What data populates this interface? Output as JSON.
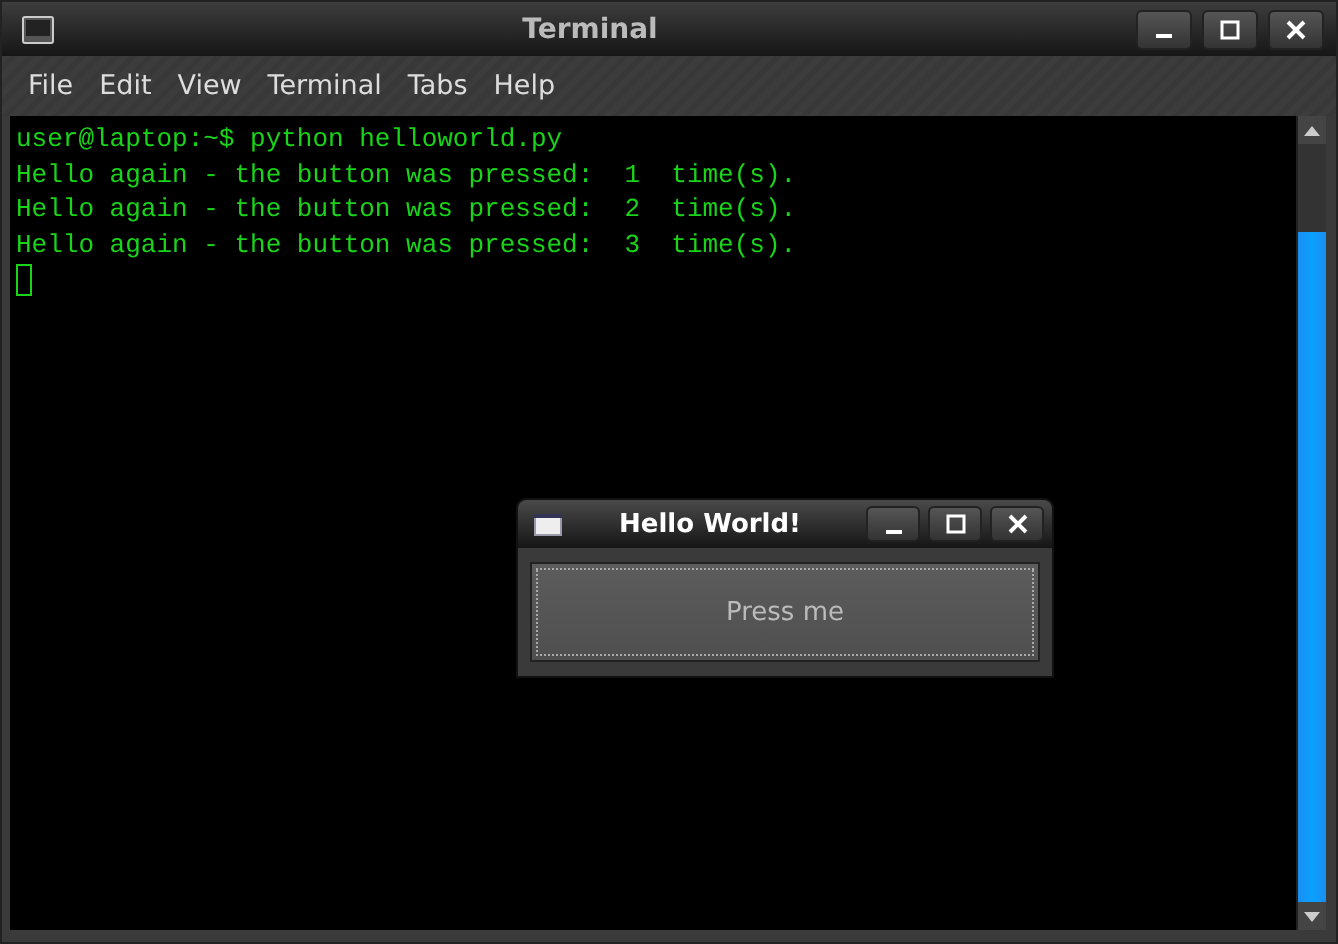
{
  "window": {
    "title": "Terminal"
  },
  "menu": [
    "File",
    "Edit",
    "View",
    "Terminal",
    "Tabs",
    "Help"
  ],
  "terminal": {
    "lines": [
      "user@laptop:~$ python helloworld.py",
      "Hello again - the button was pressed:  1  time(s).",
      "Hello again - the button was pressed:  2  time(s).",
      "Hello again - the button was pressed:  3  time(s)."
    ]
  },
  "dialog": {
    "title": "Hello World!",
    "button": "Press me"
  }
}
